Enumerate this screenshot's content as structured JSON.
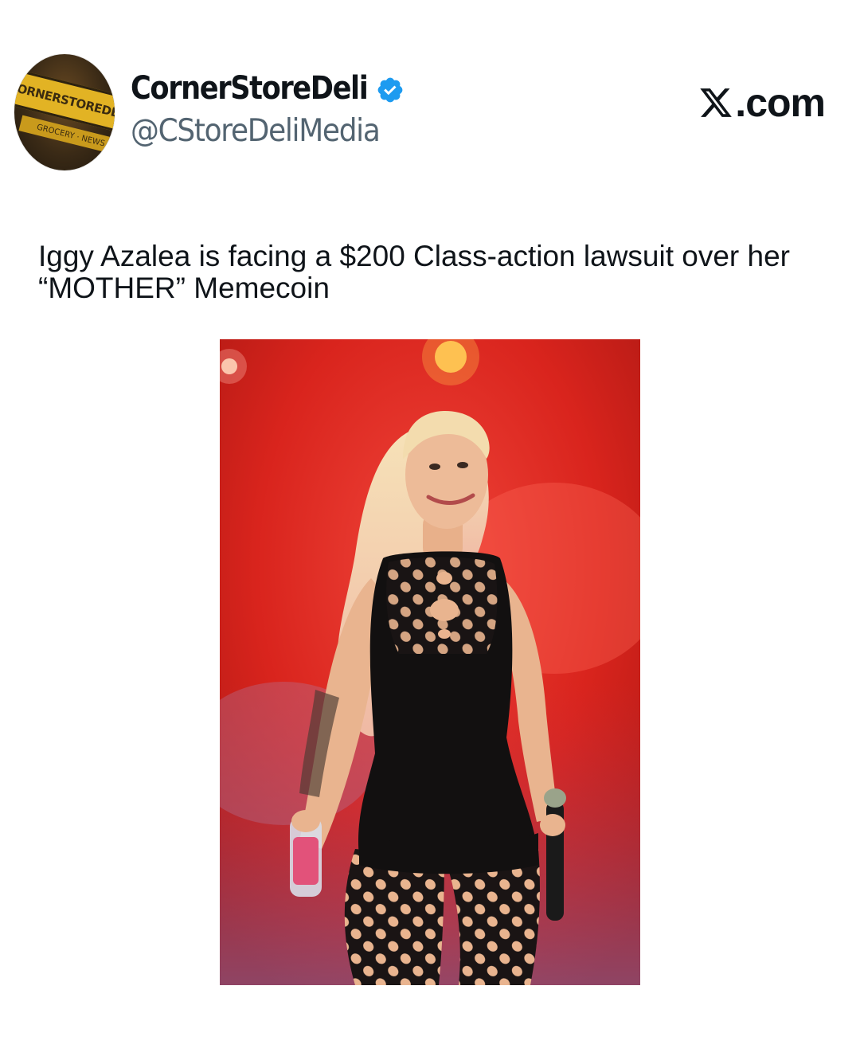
{
  "account": {
    "avatar_sign_text": "CORNERSTOREDELI",
    "avatar_sub_text": "GROCERY · NEWS",
    "display_name": "CornerStoreDeli",
    "handle": "@CStoreDeliMedia",
    "verified_icon": "verified-badge-icon",
    "verified_color": "#1d9bf0"
  },
  "brand": {
    "label": ".com",
    "icon": "x-logo-icon"
  },
  "tweet": {
    "text": "Iggy Azalea is facing a $200 Class-action lawsuit over her “MOTHER” Memecoin"
  },
  "media": {
    "description_icon": "photo",
    "colors": {
      "background": "#d7231e",
      "outfit": "#121010",
      "hair": "#f2d7a6",
      "skin": "#e9b48f"
    }
  }
}
